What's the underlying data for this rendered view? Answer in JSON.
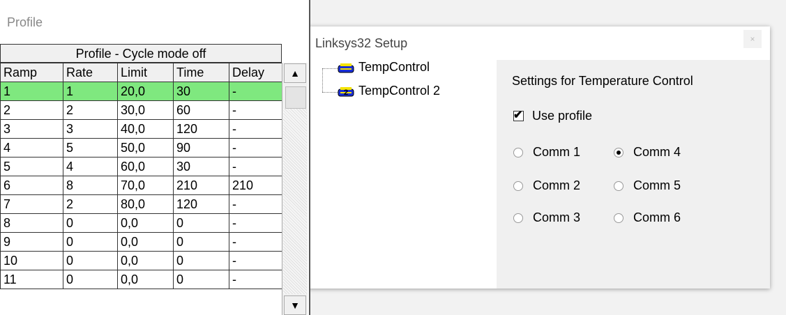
{
  "profile_window": {
    "title": "Profile",
    "grid_caption": "Profile - Cycle mode off",
    "columns": [
      "Ramp",
      "Rate",
      "Limit",
      "Time",
      "Delay"
    ],
    "rows": [
      [
        "1",
        "1",
        "20,0",
        "30",
        "-"
      ],
      [
        "2",
        "2",
        "30,0",
        "60",
        "-"
      ],
      [
        "3",
        "3",
        "40,0",
        "120",
        "-"
      ],
      [
        "4",
        "5",
        "50,0",
        "90",
        "-"
      ],
      [
        "5",
        "4",
        "60,0",
        "30",
        "-"
      ],
      [
        "6",
        "8",
        "70,0",
        "210",
        "210"
      ],
      [
        "7",
        "2",
        "80,0",
        "120",
        "-"
      ],
      [
        "8",
        "0",
        "0,0",
        "0",
        "-"
      ],
      [
        "9",
        "0",
        "0,0",
        "0",
        "-"
      ],
      [
        "10",
        "0",
        "0,0",
        "0",
        "-"
      ],
      [
        "11",
        "0",
        "0,0",
        "0",
        "-"
      ]
    ],
    "selected_row": 0,
    "highlight_color": "#7fe87f",
    "scroll_up_glyph": "▲",
    "scroll_down_glyph": "▼"
  },
  "setup_window": {
    "title": "Linksys32 Setup",
    "close_glyph": "×",
    "tree": [
      {
        "label": "TempControl",
        "icon": "device-1-icon"
      },
      {
        "label": "TempControl 2",
        "icon": "device-2-icon"
      }
    ],
    "settings": {
      "heading": "Settings for Temperature Control",
      "use_profile_label": "Use profile",
      "use_profile_checked": true,
      "check_glyph": "✔",
      "comm_ports": [
        {
          "label": "Comm 1",
          "selected": false
        },
        {
          "label": "Comm 2",
          "selected": false
        },
        {
          "label": "Comm 3",
          "selected": false
        },
        {
          "label": "Comm 4",
          "selected": true
        },
        {
          "label": "Comm 5",
          "selected": false
        },
        {
          "label": "Comm 6",
          "selected": false
        }
      ]
    }
  }
}
